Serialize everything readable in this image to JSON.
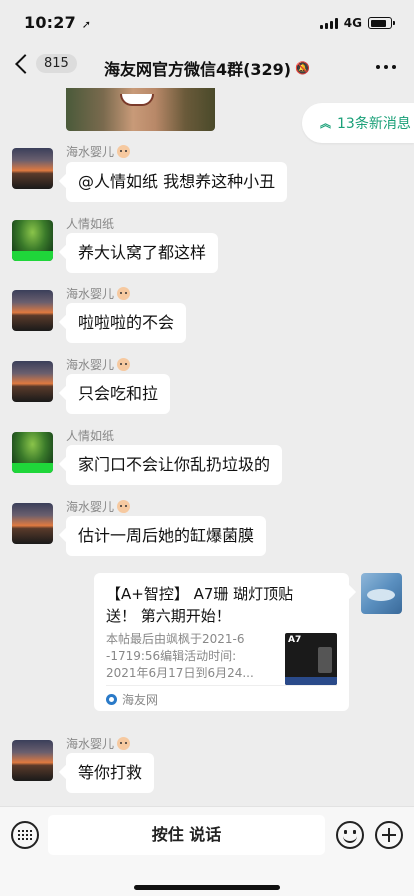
{
  "status_bar": {
    "time": "10:27",
    "network": "4G",
    "battery_level": 0.8
  },
  "header": {
    "back_count": "815",
    "title": "海友网官方微信4群(329)"
  },
  "new_messages": {
    "label": "13条新消息",
    "color": "#1aa078"
  },
  "messages": [
    {
      "sender": "海水婴儿",
      "text": "@人情如纸 我想养这种小丑"
    },
    {
      "sender": "人情如纸",
      "text": "养大认窝了都这样"
    },
    {
      "sender": "海水婴儿",
      "text": "啦啦啦的不会"
    },
    {
      "sender": "海水婴儿",
      "text": "只会吃和拉"
    },
    {
      "sender": "人情如纸",
      "text": "家门口不会让你乱扔垃圾的"
    },
    {
      "sender": "海水婴儿",
      "text": "估计一周后她的缸爆菌膜"
    },
    {
      "sender": "海水婴儿",
      "text": "等你打救"
    }
  ],
  "link_card": {
    "title_line1": "【A+智控】 A7珊 瑚灯顶贴",
    "title_line2": "送！ 第六期开始！",
    "desc_line1": "本帖最后由飒枫于2021-6",
    "desc_line2": "-1719:56编辑活动时间:",
    "desc_line3": "2021年6月17日到6月24...",
    "thumb_label": "A7",
    "source": "海友网"
  },
  "input_bar": {
    "talk_label": "按住 说话"
  },
  "icons": {
    "back": "chevron-left-icon",
    "mute": "bell-slash-icon",
    "more": "more-dots-icon",
    "new_messages": "double-chevron-up-icon",
    "keyboard": "voice-keyboard-icon",
    "emoji": "emoji-icon",
    "plus": "plus-icon"
  }
}
